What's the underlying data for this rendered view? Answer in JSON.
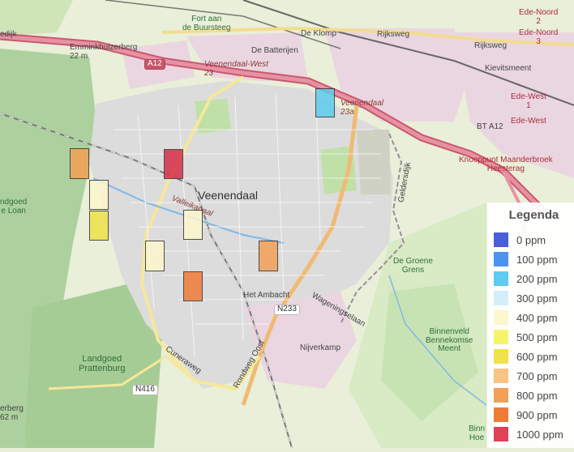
{
  "map": {
    "town_label": "Veenendaal",
    "labels": [
      {
        "text": "De Klomp",
        "kind": "sm"
      },
      {
        "text": "Fort aan\nde Buursteeg",
        "kind": "green"
      },
      {
        "text": "Ede-Noord\n2",
        "kind": "red"
      },
      {
        "text": "Ede-Noord\n3",
        "kind": "red"
      },
      {
        "text": "Emminkhuizerberg\n22 m",
        "kind": "sm"
      },
      {
        "text": "A12",
        "kind": "shield"
      },
      {
        "text": "Veenendaal-West\n23",
        "kind": "road"
      },
      {
        "text": "De Batterijen",
        "kind": "sm"
      },
      {
        "text": "Rijksweg",
        "kind": "sm"
      },
      {
        "text": "Rijksweg",
        "kind": "sm"
      },
      {
        "text": "Kievitsmeent",
        "kind": "sm"
      },
      {
        "text": "Veenendaal\n23a",
        "kind": "road"
      },
      {
        "text": "Ede-West\n1",
        "kind": "red"
      },
      {
        "text": "BT A12",
        "kind": "sm"
      },
      {
        "text": "Ede-West",
        "kind": "red"
      },
      {
        "text": "Knooppunt Maanderbroek\nHeesterag",
        "kind": "red"
      },
      {
        "text": "Valleikanaal",
        "kind": "road"
      },
      {
        "text": "Geldersdijk",
        "kind": "sm"
      },
      {
        "text": "ndgoed\ne Loan",
        "kind": "green"
      },
      {
        "text": "De Groene\nGrens",
        "kind": "green"
      },
      {
        "text": "Het Ambacht",
        "kind": "sm"
      },
      {
        "text": "N233",
        "kind": "shield"
      },
      {
        "text": "Wageningselaan",
        "kind": "sm"
      },
      {
        "text": "Binnenveld\nBennekomse\nMeent",
        "kind": "green"
      },
      {
        "text": "Nijverkamp",
        "kind": "sm"
      },
      {
        "text": "Landgoed\nPrattenburg",
        "kind": "park"
      },
      {
        "text": "Cuneraweg",
        "kind": "sm"
      },
      {
        "text": "N416",
        "kind": "shield"
      },
      {
        "text": "Rondweg Oost",
        "kind": "sm"
      },
      {
        "text": "erberg\n62 m",
        "kind": "sm"
      },
      {
        "text": "Binn\nHoe",
        "kind": "green"
      },
      {
        "text": "edijk",
        "kind": "sm"
      }
    ],
    "cells": [
      {
        "value": 200,
        "color": "#5ecbef"
      },
      {
        "value": 1000,
        "color": "#d62e4a"
      },
      {
        "value": 800,
        "color": "#f2a055"
      },
      {
        "value": 400,
        "color": "#fdf8cc"
      },
      {
        "value": 600,
        "color": "#f0e24a"
      },
      {
        "value": 400,
        "color": "#fdf8cc"
      },
      {
        "value": 400,
        "color": "#fdf8cc"
      },
      {
        "value": 800,
        "color": "#f2a055"
      },
      {
        "value": 900,
        "color": "#ee7b38"
      }
    ]
  },
  "legend": {
    "title": "Legenda",
    "items": [
      {
        "label": "0 ppm",
        "color": "#4a5fd6"
      },
      {
        "label": "100 ppm",
        "color": "#4c93f0"
      },
      {
        "label": "200 ppm",
        "color": "#5ecbef"
      },
      {
        "label": "300 ppm",
        "color": "#d3eef8"
      },
      {
        "label": "400 ppm",
        "color": "#fdf8cc"
      },
      {
        "label": "500 ppm",
        "color": "#f6f56a"
      },
      {
        "label": "600 ppm",
        "color": "#f0e24a"
      },
      {
        "label": "700 ppm",
        "color": "#f8c385"
      },
      {
        "label": "800 ppm",
        "color": "#f2a055"
      },
      {
        "label": "900 ppm",
        "color": "#ee7b38"
      },
      {
        "label": "1000 ppm",
        "color": "#e04158"
      }
    ]
  }
}
